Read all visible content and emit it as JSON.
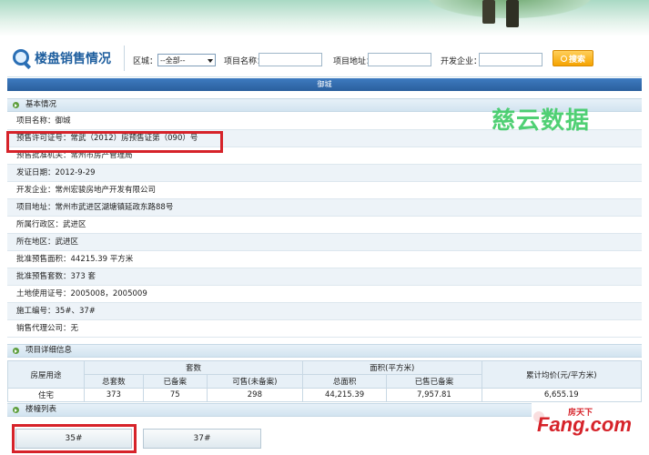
{
  "search": {
    "title": "楼盘销售情况",
    "district_label": "区城：",
    "district_value": "--全部--",
    "project_name_label": "项目名称：",
    "project_address_label": "项目地址：",
    "developer_label": "开发企业：",
    "search_button": "搜索"
  },
  "page_title": "御城",
  "basic": {
    "heading": "基本情况",
    "rows": [
      {
        "label": "项目名称：",
        "value": "御城"
      },
      {
        "label": "预售许可证号：",
        "value": "常武（2012）房预售证第（090）号"
      },
      {
        "label": "预售批准机关：",
        "value": "常州市房产管理局"
      },
      {
        "label": "发证日期：",
        "value": "2012-9-29"
      },
      {
        "label": "开发企业：",
        "value": "常州宏骏房地产开发有限公司"
      },
      {
        "label": "项目地址：",
        "value": "常州市武进区湖塘镇延政东路88号"
      },
      {
        "label": "所属行政区：",
        "value": "武进区"
      },
      {
        "label": "所在地区：",
        "value": "武进区"
      },
      {
        "label": "批准预售面积：",
        "value": "44215.39 平方米"
      },
      {
        "label": "批准预售套数：",
        "value": "373 套"
      },
      {
        "label": "土地使用证号：",
        "value": "2005008，2005009"
      },
      {
        "label": "施工编号：",
        "value": "35#、37#"
      },
      {
        "label": "销售代理公司：",
        "value": "无"
      }
    ]
  },
  "watermark": "慈云数据",
  "detail": {
    "heading": "项目详细信息",
    "headers": {
      "usage": "房屋用途",
      "units_group": "套数",
      "area_group": "面积(平方米)",
      "avg_price": "累计均价(元/平方米)",
      "total_units": "总套数",
      "recorded_units": "已备案",
      "available_units": "可售(未备案)",
      "total_area": "总面积",
      "recorded_area": "已售已备案"
    },
    "row": {
      "usage": "住宅",
      "total_units": "373",
      "recorded_units": "75",
      "available_units": "298",
      "total_area": "44,215.39",
      "recorded_area": "7,957.81",
      "avg_price": "6,655.19"
    }
  },
  "buildings": {
    "heading": "楼幢列表",
    "tabs": [
      "35#",
      "37#"
    ]
  },
  "logo": {
    "top_text": "房天下",
    "main_text": "Fang.com"
  }
}
